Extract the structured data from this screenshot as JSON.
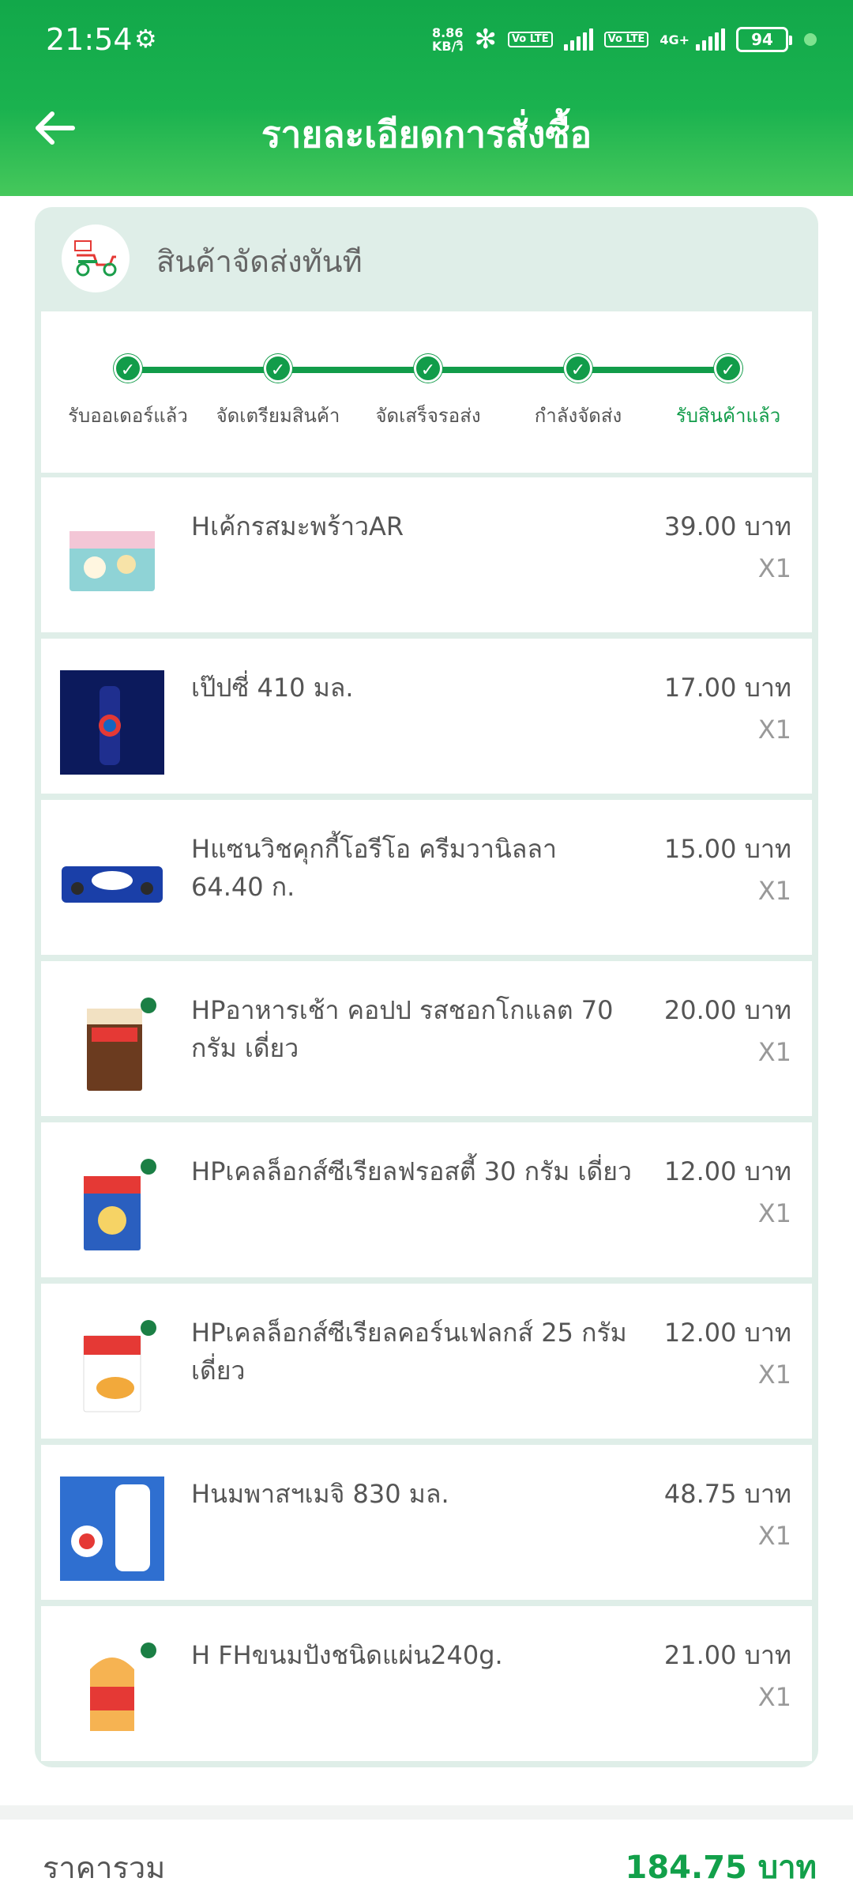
{
  "status_bar": {
    "time": "21:54",
    "net_speed_value": "8.86",
    "net_speed_unit": "KB/วิ",
    "volte1": "Vo LTE",
    "volte2": "Vo LTE",
    "network": "4G+",
    "battery": "94"
  },
  "header": {
    "title": "รายละเอียดการสั่งซื้อ",
    "back_icon": "arrow-left-icon"
  },
  "shop": {
    "title": "สินค้าจัดส่งทันที",
    "icon": "delivery-scooter-icon"
  },
  "steps": [
    {
      "label": "รับออเดอร์แล้ว"
    },
    {
      "label": "จัดเตรียมสินค้า"
    },
    {
      "label": "จัดเสร็จรอส่ง"
    },
    {
      "label": "กำลังจัดส่ง"
    },
    {
      "label": "รับสินค้าแล้ว"
    }
  ],
  "items": [
    {
      "name": "Hเค้กรสมะพร้าวAR",
      "price": "39.00 บาท",
      "qty": "X1"
    },
    {
      "name": "เป๊ปซี่ 410 มล.",
      "price": "17.00 บาท",
      "qty": "X1"
    },
    {
      "name": "Hแซนวิชคุกกี้โอรีโอ ครีมวานิลลา 64.40 ก.",
      "price": "15.00 บาท",
      "qty": "X1"
    },
    {
      "name": "HPอาหารเช้า คอปป รสชอกโกแลต 70 กรัม เดี่ยว",
      "price": "20.00 บาท",
      "qty": "X1"
    },
    {
      "name": "HPเคลล็อกส์ซีเรียลฟรอสตี้ 30 กรัม เดี่ยว",
      "price": "12.00 บาท",
      "qty": "X1"
    },
    {
      "name": "HPเคลล็อกส์ซีเรียลคอร์นเฟลกส์ 25 กรัม เดี่ยว",
      "price": "12.00 บาท",
      "qty": "X1"
    },
    {
      "name": "Hนมพาสฯเมจิ 830 มล.",
      "price": "48.75 บาท",
      "qty": "X1"
    },
    {
      "name": "H FHขนมปังชนิดแผ่น240g.",
      "price": "21.00 บาท",
      "qty": "X1"
    }
  ],
  "summary": {
    "label": "ราคารวม",
    "value": "184.75 บาท"
  },
  "colors": {
    "brand_green": "#12a84a",
    "card_bg": "#dfeee8",
    "accent_text": "#12a04a"
  }
}
